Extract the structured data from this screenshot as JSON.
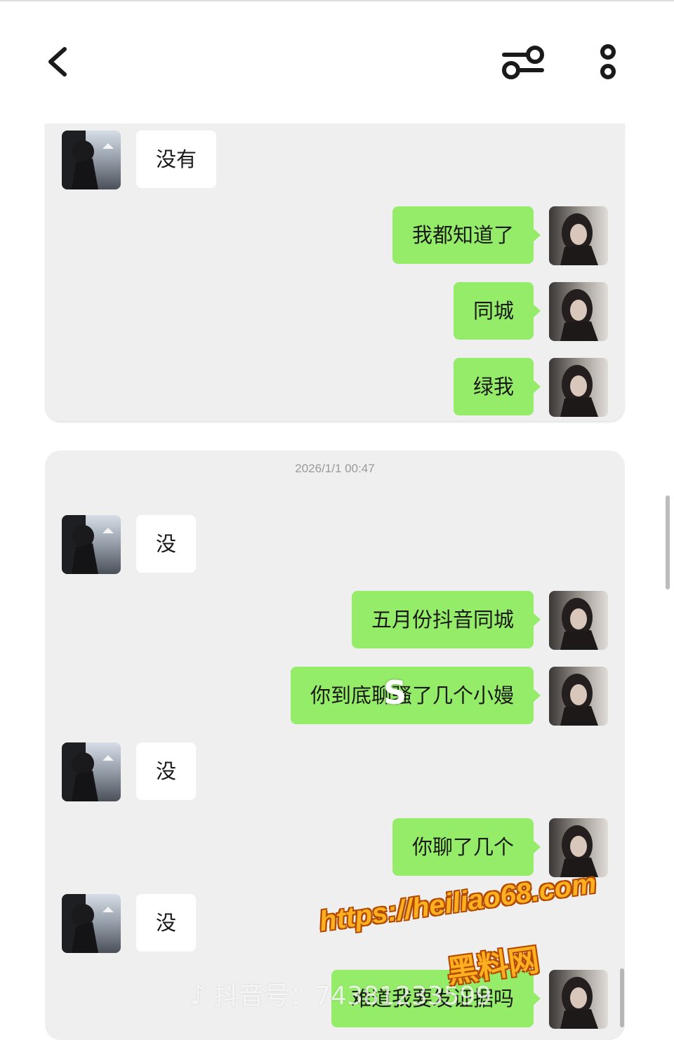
{
  "header": {
    "back_icon": "chevron-left-icon",
    "filter_icon": "sliders-icon",
    "more_icon": "more-vertical-icon"
  },
  "panel1": {
    "messages": [
      {
        "side": "left",
        "text": "没有"
      },
      {
        "side": "right",
        "text": "我都知道了"
      },
      {
        "side": "right",
        "text": "同城"
      },
      {
        "side": "right",
        "text": "绿我"
      }
    ]
  },
  "panel2": {
    "timestamp": "2026/1/1 00:47",
    "messages": [
      {
        "side": "left",
        "text": "没"
      },
      {
        "side": "right",
        "text": "五月份抖音同城"
      },
      {
        "side": "right",
        "text": "你到底聊骚了几个小嫚"
      },
      {
        "side": "left",
        "text": "没"
      },
      {
        "side": "right",
        "text": "你聊了几个"
      },
      {
        "side": "left",
        "text": "没"
      },
      {
        "side": "right",
        "text": "难道我要发证据吗"
      }
    ]
  },
  "watermarks": {
    "s_mark": "S",
    "tiktok": "抖音号：74381233599",
    "url": "https://heiliao68.com",
    "site": "黑料网"
  },
  "colors": {
    "sent_bubble": "#95ec69",
    "received_bubble": "#ffffff",
    "panel_bg": "#efefef",
    "watermark": "#ffb020"
  }
}
